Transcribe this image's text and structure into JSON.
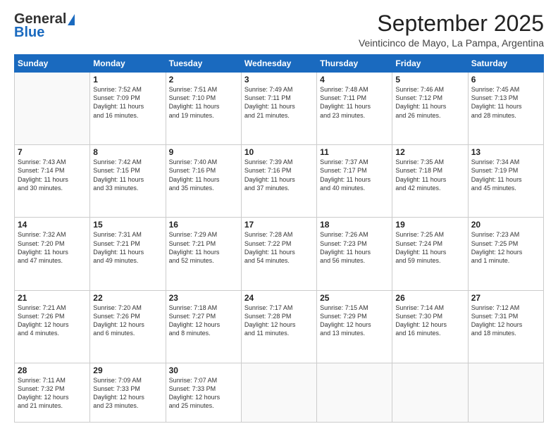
{
  "logo": {
    "line1": "General",
    "line2": "Blue"
  },
  "title": "September 2025",
  "subtitle": "Veinticinco de Mayo, La Pampa, Argentina",
  "days": [
    "Sunday",
    "Monday",
    "Tuesday",
    "Wednesday",
    "Thursday",
    "Friday",
    "Saturday"
  ],
  "weeks": [
    [
      {
        "day": "",
        "content": ""
      },
      {
        "day": "1",
        "content": "Sunrise: 7:52 AM\nSunset: 7:09 PM\nDaylight: 11 hours\nand 16 minutes."
      },
      {
        "day": "2",
        "content": "Sunrise: 7:51 AM\nSunset: 7:10 PM\nDaylight: 11 hours\nand 19 minutes."
      },
      {
        "day": "3",
        "content": "Sunrise: 7:49 AM\nSunset: 7:11 PM\nDaylight: 11 hours\nand 21 minutes."
      },
      {
        "day": "4",
        "content": "Sunrise: 7:48 AM\nSunset: 7:11 PM\nDaylight: 11 hours\nand 23 minutes."
      },
      {
        "day": "5",
        "content": "Sunrise: 7:46 AM\nSunset: 7:12 PM\nDaylight: 11 hours\nand 26 minutes."
      },
      {
        "day": "6",
        "content": "Sunrise: 7:45 AM\nSunset: 7:13 PM\nDaylight: 11 hours\nand 28 minutes."
      }
    ],
    [
      {
        "day": "7",
        "content": "Sunrise: 7:43 AM\nSunset: 7:14 PM\nDaylight: 11 hours\nand 30 minutes."
      },
      {
        "day": "8",
        "content": "Sunrise: 7:42 AM\nSunset: 7:15 PM\nDaylight: 11 hours\nand 33 minutes."
      },
      {
        "day": "9",
        "content": "Sunrise: 7:40 AM\nSunset: 7:16 PM\nDaylight: 11 hours\nand 35 minutes."
      },
      {
        "day": "10",
        "content": "Sunrise: 7:39 AM\nSunset: 7:16 PM\nDaylight: 11 hours\nand 37 minutes."
      },
      {
        "day": "11",
        "content": "Sunrise: 7:37 AM\nSunset: 7:17 PM\nDaylight: 11 hours\nand 40 minutes."
      },
      {
        "day": "12",
        "content": "Sunrise: 7:35 AM\nSunset: 7:18 PM\nDaylight: 11 hours\nand 42 minutes."
      },
      {
        "day": "13",
        "content": "Sunrise: 7:34 AM\nSunset: 7:19 PM\nDaylight: 11 hours\nand 45 minutes."
      }
    ],
    [
      {
        "day": "14",
        "content": "Sunrise: 7:32 AM\nSunset: 7:20 PM\nDaylight: 11 hours\nand 47 minutes."
      },
      {
        "day": "15",
        "content": "Sunrise: 7:31 AM\nSunset: 7:21 PM\nDaylight: 11 hours\nand 49 minutes."
      },
      {
        "day": "16",
        "content": "Sunrise: 7:29 AM\nSunset: 7:21 PM\nDaylight: 11 hours\nand 52 minutes."
      },
      {
        "day": "17",
        "content": "Sunrise: 7:28 AM\nSunset: 7:22 PM\nDaylight: 11 hours\nand 54 minutes."
      },
      {
        "day": "18",
        "content": "Sunrise: 7:26 AM\nSunset: 7:23 PM\nDaylight: 11 hours\nand 56 minutes."
      },
      {
        "day": "19",
        "content": "Sunrise: 7:25 AM\nSunset: 7:24 PM\nDaylight: 11 hours\nand 59 minutes."
      },
      {
        "day": "20",
        "content": "Sunrise: 7:23 AM\nSunset: 7:25 PM\nDaylight: 12 hours\nand 1 minute."
      }
    ],
    [
      {
        "day": "21",
        "content": "Sunrise: 7:21 AM\nSunset: 7:26 PM\nDaylight: 12 hours\nand 4 minutes."
      },
      {
        "day": "22",
        "content": "Sunrise: 7:20 AM\nSunset: 7:26 PM\nDaylight: 12 hours\nand 6 minutes."
      },
      {
        "day": "23",
        "content": "Sunrise: 7:18 AM\nSunset: 7:27 PM\nDaylight: 12 hours\nand 8 minutes."
      },
      {
        "day": "24",
        "content": "Sunrise: 7:17 AM\nSunset: 7:28 PM\nDaylight: 12 hours\nand 11 minutes."
      },
      {
        "day": "25",
        "content": "Sunrise: 7:15 AM\nSunset: 7:29 PM\nDaylight: 12 hours\nand 13 minutes."
      },
      {
        "day": "26",
        "content": "Sunrise: 7:14 AM\nSunset: 7:30 PM\nDaylight: 12 hours\nand 16 minutes."
      },
      {
        "day": "27",
        "content": "Sunrise: 7:12 AM\nSunset: 7:31 PM\nDaylight: 12 hours\nand 18 minutes."
      }
    ],
    [
      {
        "day": "28",
        "content": "Sunrise: 7:11 AM\nSunset: 7:32 PM\nDaylight: 12 hours\nand 21 minutes."
      },
      {
        "day": "29",
        "content": "Sunrise: 7:09 AM\nSunset: 7:33 PM\nDaylight: 12 hours\nand 23 minutes."
      },
      {
        "day": "30",
        "content": "Sunrise: 7:07 AM\nSunset: 7:33 PM\nDaylight: 12 hours\nand 25 minutes."
      },
      {
        "day": "",
        "content": ""
      },
      {
        "day": "",
        "content": ""
      },
      {
        "day": "",
        "content": ""
      },
      {
        "day": "",
        "content": ""
      }
    ]
  ]
}
